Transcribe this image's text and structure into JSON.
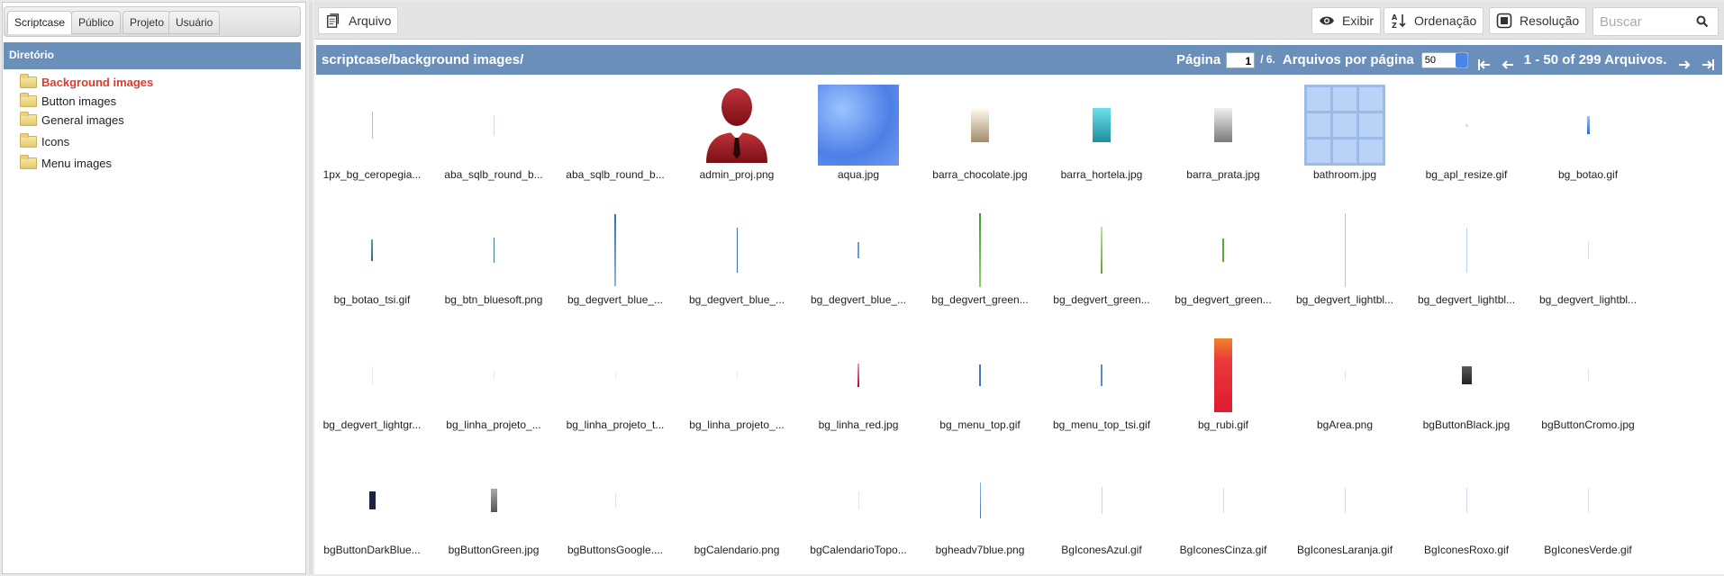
{
  "left_panel": {
    "tabs": [
      "Scriptcase",
      "Público",
      "Projeto",
      "Usuário"
    ],
    "directory_title": "Diretório",
    "tree": [
      {
        "label": "Background images",
        "selected": true
      },
      {
        "label": "Button images",
        "selected": false
      },
      {
        "label": "General images",
        "selected": false
      },
      {
        "label": "Icons",
        "selected": false
      },
      {
        "label": "Menu images",
        "selected": false
      }
    ]
  },
  "toolbar": {
    "file_label": "Arquivo",
    "view_label": "Exibir",
    "sort_label": "Ordenação",
    "resolution_label": "Resolução",
    "search_placeholder": "Buscar"
  },
  "pathbar": {
    "path": "scriptcase/background images/",
    "page_label": "Página",
    "page_value": "1",
    "page_total": "/ 6.",
    "per_page_label": "Arquivos por página",
    "per_page_value": "50",
    "range_text": "1 - 50 of 299 Arquivos."
  },
  "files": [
    "1px_bg_ceropegia...",
    "aba_sqlb_round_b...",
    "aba_sqlb_round_b...",
    "admin_proj.png",
    "aqua.jpg",
    "barra_chocolate.jpg",
    "barra_hortela.jpg",
    "barra_prata.jpg",
    "bathroom.jpg",
    "bg_apl_resize.gif",
    "bg_botao.gif",
    "bg_botao_tsi.gif",
    "bg_btn_bluesoft.png",
    "bg_degvert_blue_...",
    "bg_degvert_blue_...",
    "bg_degvert_blue_...",
    "bg_degvert_green...",
    "bg_degvert_green...",
    "bg_degvert_green...",
    "bg_degvert_lightbl...",
    "bg_degvert_lightbl...",
    "bg_degvert_lightbl...",
    "bg_degvert_lightgr...",
    "bg_linha_projeto_...",
    "bg_linha_projeto_t...",
    "bg_linha_projeto_...",
    "bg_linha_red.jpg",
    "bg_menu_top.gif",
    "bg_menu_top_tsi.gif",
    "bg_rubi.gif",
    "bgArea.png",
    "bgButtonBlack.jpg",
    "bgButtonCromo.jpg",
    "bgButtonDarkBlue...",
    "bgButtonGreen.jpg",
    "bgButtonsGoogle....",
    "bgCalendario.png",
    "bgCalendarioTopo...",
    "bgheadv7blue.png",
    "BgIconesAzul.gif",
    "BgIconesCinza.gif",
    "BgIconesLaranja.gif",
    "BgIconesRoxo.gif",
    "BgIconesVerde.gif"
  ],
  "colors": {
    "header_blue": "#6a8fba",
    "selected_red": "#e23a2e"
  }
}
